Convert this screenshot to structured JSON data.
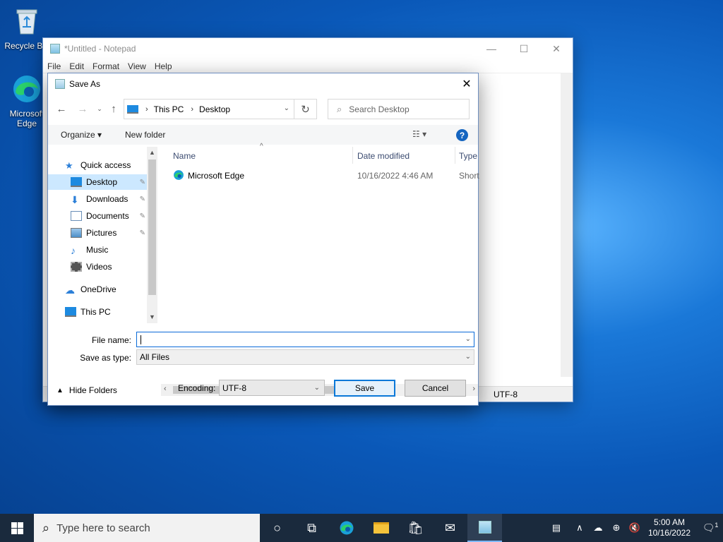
{
  "desktop": {
    "icons": [
      {
        "label": "Recycle Bin"
      },
      {
        "label": "Microsoft Edge"
      }
    ]
  },
  "notepad": {
    "title": "*Untitled - Notepad",
    "menu": [
      "File",
      "Edit",
      "Format",
      "View",
      "Help"
    ],
    "status_encoding": "UTF-8"
  },
  "dialog": {
    "title": "Save As",
    "breadcrumb": [
      "This PC",
      "Desktop"
    ],
    "search_placeholder": "Search Desktop",
    "toolbar": {
      "organize": "Organize ▾",
      "new_folder": "New folder"
    },
    "nav_items": [
      {
        "label": "Quick access",
        "icon": "star-icon",
        "selected": false,
        "pinned": false
      },
      {
        "label": "Desktop",
        "icon": "desktop-folder-icon",
        "selected": true,
        "pinned": true
      },
      {
        "label": "Downloads",
        "icon": "downloads-icon",
        "selected": false,
        "pinned": true
      },
      {
        "label": "Documents",
        "icon": "documents-icon",
        "selected": false,
        "pinned": true
      },
      {
        "label": "Pictures",
        "icon": "pictures-icon",
        "selected": false,
        "pinned": true
      },
      {
        "label": "Music",
        "icon": "music-icon",
        "selected": false,
        "pinned": false
      },
      {
        "label": "Videos",
        "icon": "videos-icon",
        "selected": false,
        "pinned": false
      },
      {
        "label": "OneDrive",
        "icon": "onedrive-icon",
        "selected": false,
        "pinned": false
      },
      {
        "label": "This PC",
        "icon": "this-pc-icon",
        "selected": false,
        "pinned": false
      }
    ],
    "columns": {
      "name": "Name",
      "date": "Date modified",
      "type": "Type"
    },
    "files": [
      {
        "name": "Microsoft Edge",
        "date": "10/16/2022 4:46 AM",
        "type": "Short"
      }
    ],
    "file_name_label": "File name:",
    "file_name_value": "",
    "save_type_label": "Save as type:",
    "save_type_value": "All Files",
    "hide_folders": "Hide Folders",
    "encoding_label": "Encoding:",
    "encoding_value": "UTF-8",
    "save_button": "Save",
    "cancel_button": "Cancel"
  },
  "taskbar": {
    "search_placeholder": "Type here to search",
    "time": "5:00 AM",
    "date": "10/16/2022",
    "notifications": "1"
  },
  "colors": {
    "accent": "#0a78d8",
    "selection": "#cce8ff",
    "taskbar": "#1a2a3d"
  }
}
